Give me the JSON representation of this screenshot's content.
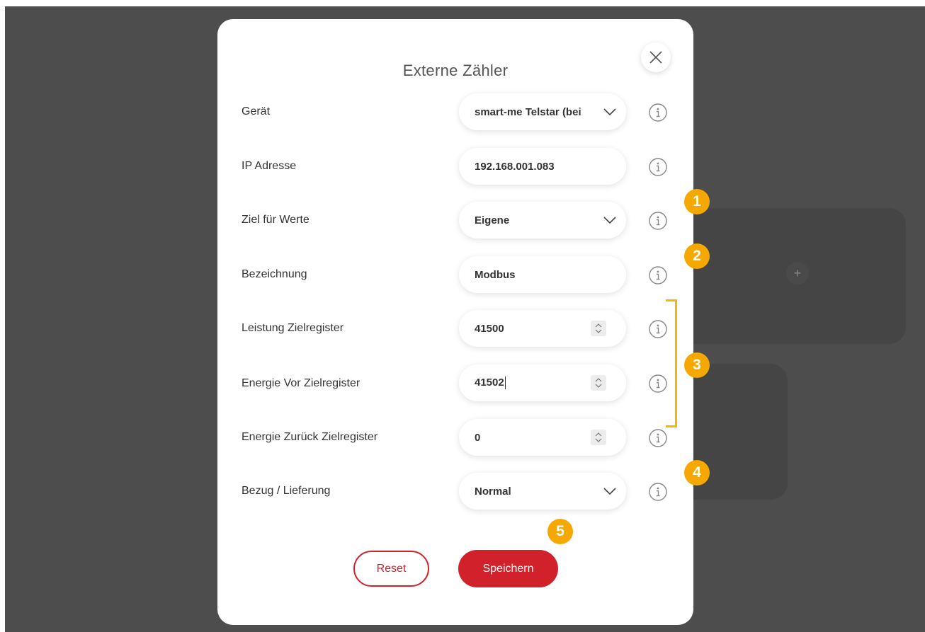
{
  "modal": {
    "title": "Externe Zähler",
    "close_icon": "close-icon"
  },
  "fields": {
    "geraet": {
      "label": "Gerät",
      "value": "smart-me Telstar (bei"
    },
    "ip": {
      "label": "IP Adresse",
      "value": "192.168.001.083"
    },
    "ziel": {
      "label": "Ziel für Werte",
      "value": "Eigene"
    },
    "bezeichnung": {
      "label": "Bezeichnung",
      "value": "Modbus"
    },
    "leistung": {
      "label": "Leistung Zielregister",
      "value": "41500"
    },
    "energie_vor": {
      "label": "Energie Vor Zielregister",
      "value": "41502"
    },
    "energie_zurueck": {
      "label": "Energie Zurück Zielregister",
      "value": "0"
    },
    "bezug": {
      "label": "Bezug / Lieferung",
      "value": "Normal"
    }
  },
  "buttons": {
    "reset": "Reset",
    "save": "Speichern"
  },
  "annotations": {
    "badges": [
      "1",
      "2",
      "3",
      "4",
      "5"
    ],
    "color": "#f5a800"
  },
  "background": {
    "plus": "+"
  },
  "colors": {
    "accent": "#d1222c",
    "backdrop": "#4d4d4d",
    "badge": "#f5a800"
  }
}
